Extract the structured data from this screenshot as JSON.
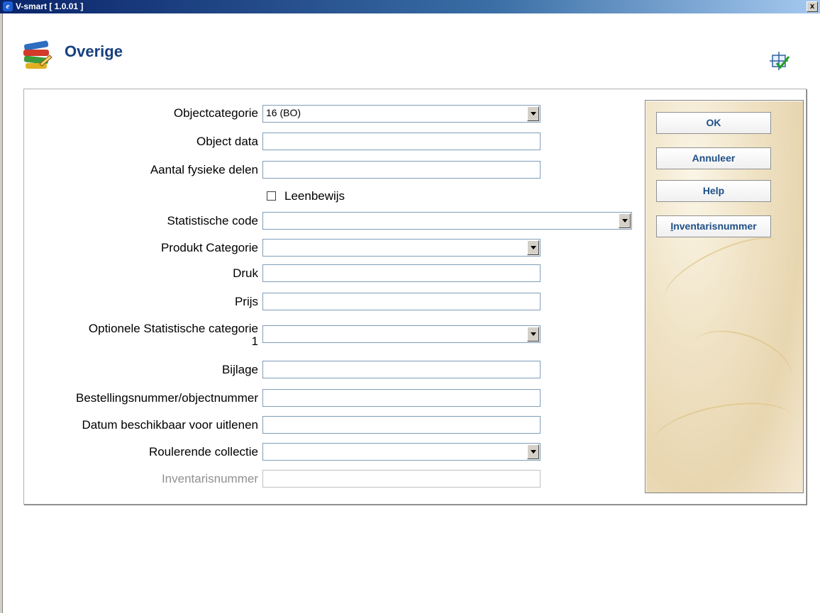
{
  "window": {
    "title": "V-smart [ 1.0.01 ]",
    "close_label": "x"
  },
  "header": {
    "title": "Overige"
  },
  "form": {
    "objectcategorie": {
      "label": "Objectcategorie",
      "value": "16 (BO)"
    },
    "object_data": {
      "label": "Object data",
      "value": ""
    },
    "aantal_fysieke_delen": {
      "label": "Aantal fysieke delen",
      "value": ""
    },
    "leenbewijs": {
      "label": "Leenbewijs",
      "checked": false
    },
    "statistische_code": {
      "label": "Statistische code",
      "value": ""
    },
    "produkt_categorie": {
      "label": "Produkt Categorie",
      "value": ""
    },
    "druk": {
      "label": "Druk",
      "value": ""
    },
    "prijs": {
      "label": "Prijs",
      "value": ""
    },
    "optionele_statistische_categorie": {
      "label_line1": "Optionele Statistische categorie",
      "label_line2": "1",
      "value": ""
    },
    "bijlage": {
      "label": "Bijlage",
      "value": ""
    },
    "bestellingsnummer": {
      "label": "Bestellingsnummer/objectnummer",
      "value": ""
    },
    "datum_beschikbaar": {
      "label": "Datum beschikbaar voor uitlenen",
      "value": ""
    },
    "roulerende_collectie": {
      "label": "Roulerende collectie",
      "value": ""
    },
    "inventarisnummer": {
      "label": "Inventarisnummer",
      "value": ""
    }
  },
  "buttons": {
    "ok": "OK",
    "annuleer": "Annuleer",
    "help": "Help",
    "inventarisnummer_first": "I",
    "inventarisnummer_rest": "nventarisnummer"
  },
  "colors": {
    "title_accent": "#16407f",
    "button_text": "#1e4f86",
    "titlebar": "#0a246a"
  }
}
